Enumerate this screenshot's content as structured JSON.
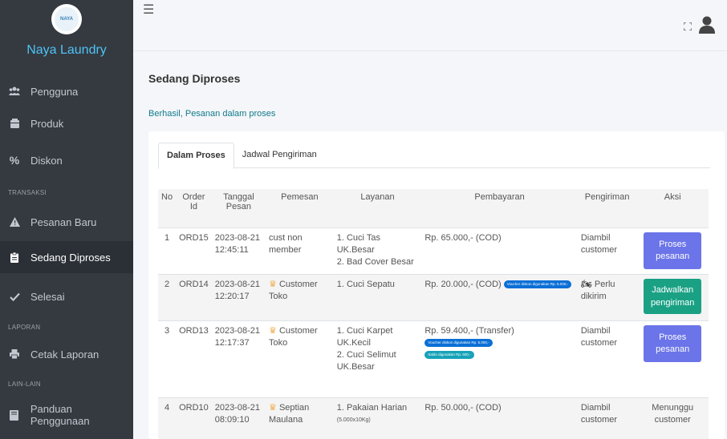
{
  "sidebar": {
    "logo_text": "NAYA",
    "brand": "Naya Laundry",
    "items": [
      {
        "label": "Pengguna",
        "icon": "users-icon"
      },
      {
        "label": "Produk",
        "icon": "box-icon"
      },
      {
        "label": "Diskon",
        "icon": "percent-icon"
      },
      {
        "label": "Pesanan Baru",
        "icon": "warning-icon"
      },
      {
        "label": "Sedang Diproses",
        "icon": "clipboard-icon"
      },
      {
        "label": "Selesai",
        "icon": "check-icon"
      },
      {
        "label": "Cetak Laporan",
        "icon": "print-icon"
      },
      {
        "label": "Panduan Penggunaan",
        "icon": "book-icon"
      }
    ],
    "headers": [
      "TRANSAKSI",
      "LAPORAN",
      "LAIN-LAIN"
    ]
  },
  "topbar": {
    "menu_icon": "hamburger-icon",
    "expand_icon": "expand-icon",
    "user_icon": "user-icon"
  },
  "page": {
    "title": "Sedang Diproses",
    "success_message": "Berhasil, Pesanan dalam proses"
  },
  "tabs": [
    "Dalam Proses",
    "Jadwal Pengiriman"
  ],
  "table": {
    "headers": {
      "no": "No",
      "order_id": "Order Id",
      "tanggal": "Tanggal Pesan",
      "pemesan": "Pemesan",
      "layanan": "Layanan",
      "pembayaran": "Pembayaran",
      "pengiriman": "Pengiriman",
      "aksi": "Aksi"
    },
    "rows": [
      {
        "no": "1",
        "order_id": "ORD15",
        "date": "2023-08-21",
        "time": "12:45:11",
        "pemesan": "cust non member",
        "pemesan_crown": false,
        "layanan": [
          "1. Cuci Tas UK.Besar",
          "2. Bad Cover Besar"
        ],
        "pembayaran": "Rp. 65.000,- (COD)",
        "pengiriman": "Diambil customer",
        "aksi": "Proses pesanan"
      },
      {
        "no": "2",
        "order_id": "ORD14",
        "date": "2023-08-21",
        "time": "12:20:17",
        "pemesan": "Customer Toko",
        "pemesan_crown": true,
        "layanan": [
          "1. Cuci Sepatu"
        ],
        "pembayaran": "Rp. 20.000,- (COD)",
        "pembayaran_pill": "Voucher diskon digunakan Rp. 5.000,-",
        "pengiriman": "Perlu dikirim",
        "aksi": "Jadwalkan pengiriman"
      },
      {
        "no": "3",
        "order_id": "ORD13",
        "date": "2023-08-21",
        "time": "12:17:37",
        "pemesan": "Customer Toko",
        "pemesan_crown": true,
        "layanan": [
          "1. Cuci Karpet UK.Kecil",
          "2. Cuci Selimut UK.Besar"
        ],
        "pembayaran": "Rp. 59.400,- (Transfer)",
        "pembayaran_pill": "Voucher diskon digunakan Rp. 5.000,-",
        "pembayaran_pill2": "Saldo digunakan Rp. 600,-",
        "pengiriman": "Diambil customer",
        "aksi": "Proses pesanan"
      },
      {
        "no": "4",
        "order_id": "ORD10",
        "date": "2023-08-21",
        "time": "08:09:10",
        "pemesan": "Septian Maulana",
        "pemesan_crown": true,
        "layanan": [
          "1. Pakaian Harian",
          "(5.000x10Kg)"
        ],
        "pembayaran": "Rp. 50.000,- (COD)",
        "pengiriman": "Diambil customer",
        "aksi": "Menunggu customer"
      }
    ]
  }
}
